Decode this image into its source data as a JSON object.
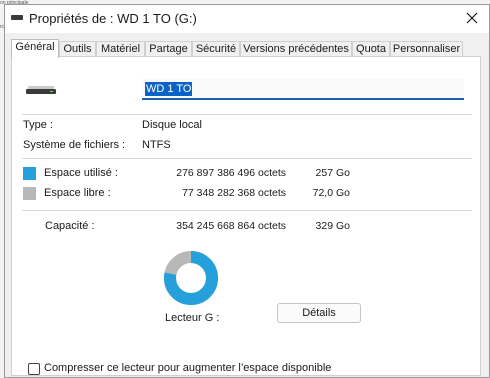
{
  "background": {
    "crumb_top": "on principale",
    "crumb_left": "rc"
  },
  "window": {
    "title": "Propriétés de : WD 1 TO (G:)",
    "close_icon": "close-icon"
  },
  "tabs": [
    {
      "label": "Général",
      "active": true
    },
    {
      "label": "Outils",
      "active": false
    },
    {
      "label": "Matériel",
      "active": false
    },
    {
      "label": "Partage",
      "active": false
    },
    {
      "label": "Sécurité",
      "active": false
    },
    {
      "label": "Versions précédentes",
      "active": false
    },
    {
      "label": "Quota",
      "active": false
    },
    {
      "label": "Personnaliser",
      "active": false
    }
  ],
  "general": {
    "drive_icon": "hard-drive-icon",
    "name_value": "WD 1 TO",
    "type_label": "Type :",
    "type_value": "Disque local",
    "fs_label": "Système de fichiers :",
    "fs_value": "NTFS",
    "used": {
      "label": "Espace utilisé :",
      "bytes": "276 897 386 496 octets",
      "human": "257 Go",
      "color": "#26a0da"
    },
    "free": {
      "label": "Espace libre :",
      "bytes": "77 348 282 368 octets",
      "human": "72,0 Go",
      "color": "#b8b8b8"
    },
    "capacity": {
      "label": "Capacité :",
      "bytes": "354 245 668 864 octets",
      "human": "329 Go"
    },
    "used_fraction": 0.7817,
    "drive_label": "Lecteur G :",
    "details_button": "Détails",
    "compress_label": "Compresser ce lecteur pour augmenter l’espace disponible",
    "compress_checked": false
  }
}
